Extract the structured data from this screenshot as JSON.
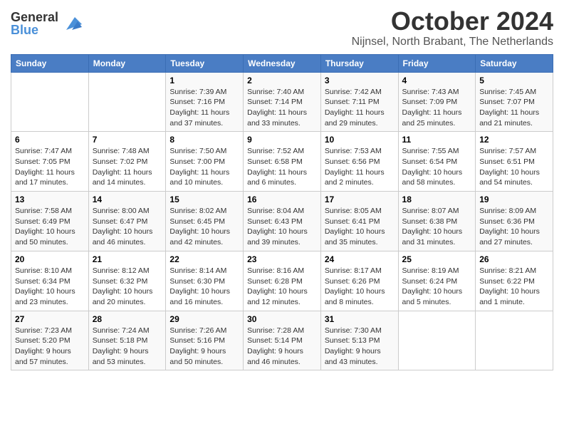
{
  "logo": {
    "general": "General",
    "blue": "Blue"
  },
  "title": "October 2024",
  "location": "Nijnsel, North Brabant, The Netherlands",
  "days_of_week": [
    "Sunday",
    "Monday",
    "Tuesday",
    "Wednesday",
    "Thursday",
    "Friday",
    "Saturday"
  ],
  "weeks": [
    [
      {
        "day": "",
        "sunrise": "",
        "sunset": "",
        "daylight": ""
      },
      {
        "day": "",
        "sunrise": "",
        "sunset": "",
        "daylight": ""
      },
      {
        "day": "1",
        "sunrise": "Sunrise: 7:39 AM",
        "sunset": "Sunset: 7:16 PM",
        "daylight": "Daylight: 11 hours and 37 minutes."
      },
      {
        "day": "2",
        "sunrise": "Sunrise: 7:40 AM",
        "sunset": "Sunset: 7:14 PM",
        "daylight": "Daylight: 11 hours and 33 minutes."
      },
      {
        "day": "3",
        "sunrise": "Sunrise: 7:42 AM",
        "sunset": "Sunset: 7:11 PM",
        "daylight": "Daylight: 11 hours and 29 minutes."
      },
      {
        "day": "4",
        "sunrise": "Sunrise: 7:43 AM",
        "sunset": "Sunset: 7:09 PM",
        "daylight": "Daylight: 11 hours and 25 minutes."
      },
      {
        "day": "5",
        "sunrise": "Sunrise: 7:45 AM",
        "sunset": "Sunset: 7:07 PM",
        "daylight": "Daylight: 11 hours and 21 minutes."
      }
    ],
    [
      {
        "day": "6",
        "sunrise": "Sunrise: 7:47 AM",
        "sunset": "Sunset: 7:05 PM",
        "daylight": "Daylight: 11 hours and 17 minutes."
      },
      {
        "day": "7",
        "sunrise": "Sunrise: 7:48 AM",
        "sunset": "Sunset: 7:02 PM",
        "daylight": "Daylight: 11 hours and 14 minutes."
      },
      {
        "day": "8",
        "sunrise": "Sunrise: 7:50 AM",
        "sunset": "Sunset: 7:00 PM",
        "daylight": "Daylight: 11 hours and 10 minutes."
      },
      {
        "day": "9",
        "sunrise": "Sunrise: 7:52 AM",
        "sunset": "Sunset: 6:58 PM",
        "daylight": "Daylight: 11 hours and 6 minutes."
      },
      {
        "day": "10",
        "sunrise": "Sunrise: 7:53 AM",
        "sunset": "Sunset: 6:56 PM",
        "daylight": "Daylight: 11 hours and 2 minutes."
      },
      {
        "day": "11",
        "sunrise": "Sunrise: 7:55 AM",
        "sunset": "Sunset: 6:54 PM",
        "daylight": "Daylight: 10 hours and 58 minutes."
      },
      {
        "day": "12",
        "sunrise": "Sunrise: 7:57 AM",
        "sunset": "Sunset: 6:51 PM",
        "daylight": "Daylight: 10 hours and 54 minutes."
      }
    ],
    [
      {
        "day": "13",
        "sunrise": "Sunrise: 7:58 AM",
        "sunset": "Sunset: 6:49 PM",
        "daylight": "Daylight: 10 hours and 50 minutes."
      },
      {
        "day": "14",
        "sunrise": "Sunrise: 8:00 AM",
        "sunset": "Sunset: 6:47 PM",
        "daylight": "Daylight: 10 hours and 46 minutes."
      },
      {
        "day": "15",
        "sunrise": "Sunrise: 8:02 AM",
        "sunset": "Sunset: 6:45 PM",
        "daylight": "Daylight: 10 hours and 42 minutes."
      },
      {
        "day": "16",
        "sunrise": "Sunrise: 8:04 AM",
        "sunset": "Sunset: 6:43 PM",
        "daylight": "Daylight: 10 hours and 39 minutes."
      },
      {
        "day": "17",
        "sunrise": "Sunrise: 8:05 AM",
        "sunset": "Sunset: 6:41 PM",
        "daylight": "Daylight: 10 hours and 35 minutes."
      },
      {
        "day": "18",
        "sunrise": "Sunrise: 8:07 AM",
        "sunset": "Sunset: 6:38 PM",
        "daylight": "Daylight: 10 hours and 31 minutes."
      },
      {
        "day": "19",
        "sunrise": "Sunrise: 8:09 AM",
        "sunset": "Sunset: 6:36 PM",
        "daylight": "Daylight: 10 hours and 27 minutes."
      }
    ],
    [
      {
        "day": "20",
        "sunrise": "Sunrise: 8:10 AM",
        "sunset": "Sunset: 6:34 PM",
        "daylight": "Daylight: 10 hours and 23 minutes."
      },
      {
        "day": "21",
        "sunrise": "Sunrise: 8:12 AM",
        "sunset": "Sunset: 6:32 PM",
        "daylight": "Daylight: 10 hours and 20 minutes."
      },
      {
        "day": "22",
        "sunrise": "Sunrise: 8:14 AM",
        "sunset": "Sunset: 6:30 PM",
        "daylight": "Daylight: 10 hours and 16 minutes."
      },
      {
        "day": "23",
        "sunrise": "Sunrise: 8:16 AM",
        "sunset": "Sunset: 6:28 PM",
        "daylight": "Daylight: 10 hours and 12 minutes."
      },
      {
        "day": "24",
        "sunrise": "Sunrise: 8:17 AM",
        "sunset": "Sunset: 6:26 PM",
        "daylight": "Daylight: 10 hours and 8 minutes."
      },
      {
        "day": "25",
        "sunrise": "Sunrise: 8:19 AM",
        "sunset": "Sunset: 6:24 PM",
        "daylight": "Daylight: 10 hours and 5 minutes."
      },
      {
        "day": "26",
        "sunrise": "Sunrise: 8:21 AM",
        "sunset": "Sunset: 6:22 PM",
        "daylight": "Daylight: 10 hours and 1 minute."
      }
    ],
    [
      {
        "day": "27",
        "sunrise": "Sunrise: 7:23 AM",
        "sunset": "Sunset: 5:20 PM",
        "daylight": "Daylight: 9 hours and 57 minutes."
      },
      {
        "day": "28",
        "sunrise": "Sunrise: 7:24 AM",
        "sunset": "Sunset: 5:18 PM",
        "daylight": "Daylight: 9 hours and 53 minutes."
      },
      {
        "day": "29",
        "sunrise": "Sunrise: 7:26 AM",
        "sunset": "Sunset: 5:16 PM",
        "daylight": "Daylight: 9 hours and 50 minutes."
      },
      {
        "day": "30",
        "sunrise": "Sunrise: 7:28 AM",
        "sunset": "Sunset: 5:14 PM",
        "daylight": "Daylight: 9 hours and 46 minutes."
      },
      {
        "day": "31",
        "sunrise": "Sunrise: 7:30 AM",
        "sunset": "Sunset: 5:13 PM",
        "daylight": "Daylight: 9 hours and 43 minutes."
      },
      {
        "day": "",
        "sunrise": "",
        "sunset": "",
        "daylight": ""
      },
      {
        "day": "",
        "sunrise": "",
        "sunset": "",
        "daylight": ""
      }
    ]
  ]
}
